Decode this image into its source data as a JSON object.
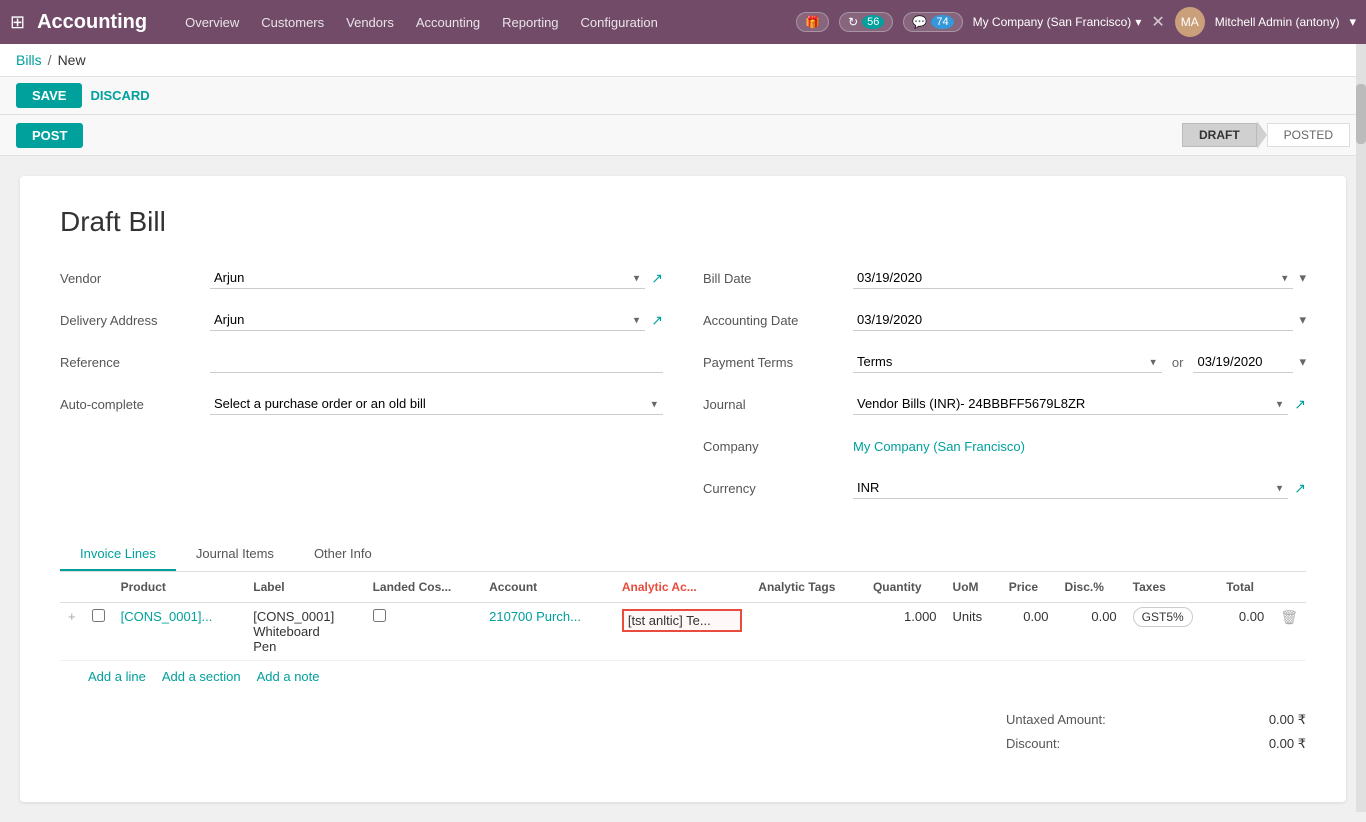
{
  "app": {
    "title": "Accounting",
    "grid_icon": "⊞"
  },
  "navbar": {
    "links": [
      "Overview",
      "Customers",
      "Vendors",
      "Accounting",
      "Reporting",
      "Configuration"
    ],
    "badge1_icon": "🎁",
    "badge2_count": "56",
    "badge3_count": "74",
    "company": "My Company (San Francisco)",
    "close_icon": "✕",
    "user": "Mitchell Admin (antony)"
  },
  "breadcrumb": {
    "parent": "Bills",
    "separator": "/",
    "current": "New"
  },
  "buttons": {
    "save": "SAVE",
    "discard": "DISCARD",
    "post": "POST"
  },
  "status": {
    "draft": "DRAFT",
    "posted": "POSTED"
  },
  "form": {
    "title": "Draft Bill",
    "vendor_label": "Vendor",
    "vendor_value": "Arjun",
    "delivery_label": "Delivery Address",
    "delivery_value": "Arjun",
    "reference_label": "Reference",
    "reference_value": "",
    "autocomplete_label": "Auto-complete",
    "autocomplete_placeholder": "Select a purchase order or an old bill",
    "bill_date_label": "Bill Date",
    "bill_date_value": "03/19/2020",
    "accounting_date_label": "Accounting Date",
    "accounting_date_value": "03/19/2020",
    "payment_terms_label": "Payment Terms",
    "payment_terms_value": "Terms",
    "payment_terms_or": "or",
    "payment_terms_date": "03/19/2020",
    "journal_label": "Journal",
    "journal_value": "Vendor Bills (INR)- 24BBBFF5679L8ZR",
    "company_label": "Company",
    "company_value": "My Company (San Francisco)",
    "currency_label": "Currency",
    "currency_value": "INR"
  },
  "tabs": [
    {
      "id": "invoice-lines",
      "label": "Invoice Lines",
      "active": true
    },
    {
      "id": "journal-items",
      "label": "Journal Items",
      "active": false
    },
    {
      "id": "other-info",
      "label": "Other Info",
      "active": false
    }
  ],
  "table": {
    "columns": [
      "Product",
      "Label",
      "Landed Cos...",
      "Account",
      "Analytic Ac...",
      "Analytic Tags",
      "Quantity",
      "UoM",
      "Price",
      "Disc.%",
      "Taxes",
      "Total"
    ],
    "rows": [
      {
        "product": "[CONS_0001]...",
        "label_line1": "[CONS_0001]",
        "label_line2": "Whiteboard",
        "label_line3": "Pen",
        "landed_cost": "",
        "account": "210700 Purch...",
        "analytic_ac": "[tst anltic] Te...",
        "analytic_tags": "",
        "quantity": "1.000",
        "uom": "Units",
        "price": "0.00",
        "disc": "0.00",
        "taxes": "GST5%",
        "total": "0.00"
      }
    ],
    "add_line": "Add a line",
    "add_section": "Add a section",
    "add_note": "Add a note",
    "more_icon": "⋮"
  },
  "totals": {
    "untaxed_label": "Untaxed Amount:",
    "untaxed_value": "0.00 ₹",
    "discount_label": "Discount:",
    "discount_value": "0.00 ₹"
  }
}
